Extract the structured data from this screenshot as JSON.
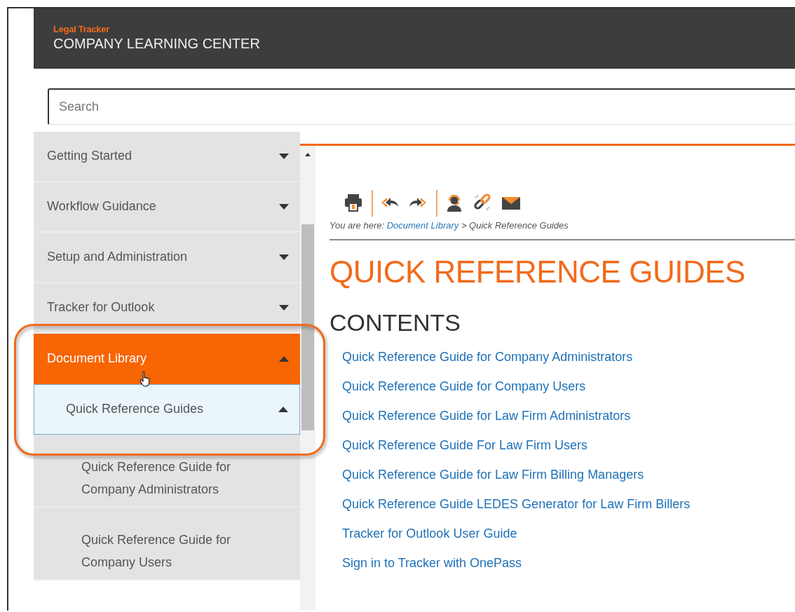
{
  "header": {
    "brand": "Legal Tracker",
    "title": "COMPANY LEARNING CENTER"
  },
  "search": {
    "placeholder": "Search"
  },
  "sidebar": {
    "items": [
      {
        "label": "Getting Started",
        "expanded": false,
        "selected": false
      },
      {
        "label": "Workflow Guidance",
        "expanded": false,
        "selected": false
      },
      {
        "label": "Setup and Administration",
        "expanded": false,
        "selected": false
      },
      {
        "label": "Tracker for Outlook",
        "expanded": false,
        "selected": false
      },
      {
        "label": "Document Library",
        "expanded": true,
        "selected": true,
        "children": [
          {
            "label": "Quick Reference Guides",
            "expanded": true,
            "selected": true,
            "children": [
              {
                "label": "Quick Reference Guide for Company Administrators",
                "selected": false
              },
              {
                "label": "Quick Reference Guide for Company Users",
                "selected": false
              }
            ]
          }
        ]
      }
    ]
  },
  "breadcrumb": {
    "prefix": "You are here:",
    "link": "Document Library",
    "separator": ">",
    "current": "Quick Reference Guides"
  },
  "page_title": "QUICK REFERENCE GUIDES",
  "contents_heading": "CONTENTS",
  "links": [
    "Quick Reference Guide for Company Administrators",
    "Quick Reference Guide for Company Users",
    "Quick Reference Guide for Law Firm Administrators",
    "Quick Reference Guide For Law Firm Users",
    "Quick Reference Guide for Law Firm Billing Managers",
    "Quick Reference Guide LEDES Generator for Law Firm Billers",
    "Tracker for Outlook User Guide",
    "Sign in to Tracker with OnePass"
  ]
}
